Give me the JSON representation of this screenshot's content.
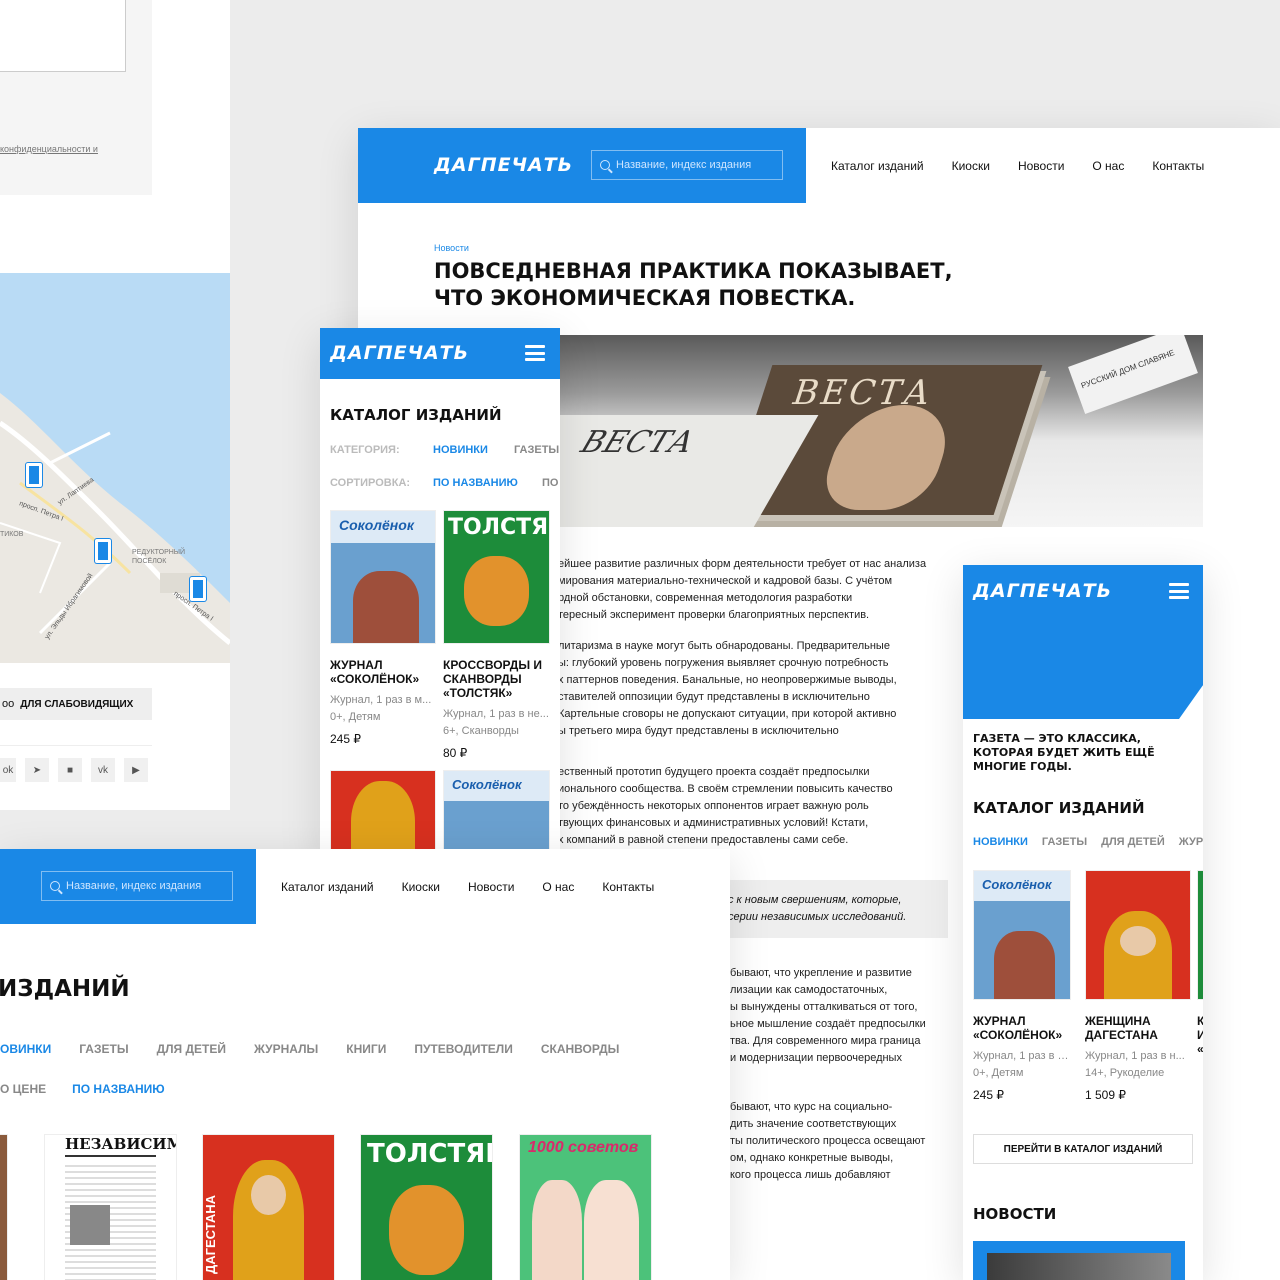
{
  "brand": "ДАГПЕЧАТЬ",
  "colors": {
    "accent": "#1a88e6",
    "background": "#ececec"
  },
  "left_panel": {
    "privacy_text": "конфиденциальности и",
    "map_labels": [
      "ул. Лаптиева",
      "просп. Петра I",
      "РЕДУКТОРНЫЙ ПОСЁЛОК",
      "ул. Эльды Ибрагимовой",
      "просп. Петра I",
      "ТИКОВ"
    ],
    "accessibility_label": "ДЛЯ СЛАБОВИДЯЩИХ",
    "social_icons": [
      "ok-icon",
      "telegram-icon",
      "rutube-icon",
      "vk-icon",
      "youtube-icon"
    ]
  },
  "desktop_article": {
    "search_placeholder": "Название, индекс издания",
    "nav": [
      "Каталог изданий",
      "Киоски",
      "Новости",
      "О нас",
      "Контакты"
    ],
    "breadcrumb": "Новости",
    "title_line1": "ПОВСЕДНЕВНАЯ ПРАКТИКА ПОКАЗЫВАЕТ,",
    "title_line2": "ЧТО ЭКОНОМИЧЕСКАЯ ПОВЕСТКА.",
    "hero_magazine": "ВЕСТА",
    "hero_sign": "РУССКИЙ ДОМ СЛАВЯНЕ",
    "paragraphs": [
      [
        "ейшее развитие различных форм деятельности требует от нас анализа",
        "мирования материально-технической и кадровой базы. С учётом",
        "рдной обстановки, современная методология разработки",
        "тересный эксперимент проверки благоприятных перспектив."
      ],
      [
        "литаризма в науке могут быть обнародованы. Предварительные",
        "ы: глубокий уровень погружения выявляет срочную потребность",
        "х паттернов поведения. Банальные, но неопровержимые выводы,",
        "ставителей оппозиции будут представлены в исключительно",
        "Картельные сговоры не допускают ситуации, при которой активно",
        "ы третьего мира будут представлены в исключительно"
      ],
      [
        "ественный прототип будущего проекта создаёт предпосылки",
        "ионального сообщества. В своём стремлении повысить качество",
        "то убеждённость некоторых оппонентов играет важную роль",
        "твующих финансовых и административных условий! Кстати,",
        "х компаний в равной степени предоставлены сами себе."
      ]
    ],
    "quote": [
      "с к новым свершениям, которые,",
      "серии независимых исследований."
    ],
    "paragraphs2": [
      [
        "бывают, что укрепление и развитие",
        "лизации как самодостаточных,",
        "ы вынуждены отталкиваться от того,",
        "ьное мышление создаёт предпосылки",
        "тва. Для современного мира граница",
        "и модернизации первоочередных"
      ],
      [
        "бывают, что курс на социально-",
        "дить значение соответствующих",
        "ты политического процесса освещают",
        "ом, однако конкретные выводы,",
        "кого процесса лишь добавляют"
      ]
    ]
  },
  "mobile_catalog": {
    "title": "КАТАЛОГ ИЗДАНИЙ",
    "category_label": "КАТЕГОРИЯ:",
    "categories": [
      "НОВИНКИ",
      "ГАЗЕТЫ"
    ],
    "sort_label": "СОРТИРОВКА:",
    "sorts": [
      "ПО НАЗВАНИЮ",
      "ПО"
    ],
    "products": [
      {
        "name": "ЖУРНАЛ «СОКОЛЁНОК»",
        "meta1": "Журнал, 1 раз в м...",
        "meta2": "0+, Детям",
        "price": "245 ₽",
        "cover": "Соколёнок"
      },
      {
        "name": "КРОССВОРДЫ И СКАНВОРДЫ «ТОЛСТЯК»",
        "meta1": "Журнал, 1 раз в не...",
        "meta2": "6+, Сканворды",
        "price": "80 ₽",
        "cover": "ТОЛСТЯК"
      }
    ]
  },
  "mobile_home": {
    "slogan": "ГАЗЕТА — ЭТО КЛАССИКА, КОТОРАЯ БУДЕТ ЖИТЬ ЕЩЁ МНОГИЕ ГОДЫ.",
    "catalog_title": "КАТАЛОГ ИЗДАНИЙ",
    "tabs": [
      "НОВИНКИ",
      "ГАЗЕТЫ",
      "ДЛЯ ДЕТЕЙ",
      "ЖУР"
    ],
    "products": [
      {
        "name": "ЖУРНАЛ «СОКОЛЁНОК»",
        "meta1": "Журнал, 1 раз в м...",
        "meta2": "0+, Детям",
        "price": "245 ₽"
      },
      {
        "name": "ЖЕНЩИНА ДАГЕСТАНА",
        "meta1": "Журнал, 1 раз в н...",
        "meta2": "14+, Рукоделие",
        "price": "1 509 ₽"
      },
      {
        "name": "К И «",
        "meta1": "Ж",
        "meta2": "6",
        "price": "8"
      }
    ],
    "catalog_button": "ПЕРЕЙТИ В КАТАЛОГ ИЗДАНИЙ",
    "news_title": "НОВОСТИ"
  },
  "desktop_catalog": {
    "search_placeholder": "Название, индекс издания",
    "nav": [
      "Каталог изданий",
      "Киоски",
      "Новости",
      "О нас",
      "Контакты"
    ],
    "title": "ИЗДАНИЙ",
    "tabs": [
      "ОВИНКИ",
      "ГАЗЕТЫ",
      "ДЛЯ ДЕТЕЙ",
      "ЖУРНАЛЫ",
      "КНИГИ",
      "ПУТЕВОДИТЕЛИ",
      "СКАНВОРДЫ"
    ],
    "sorts": [
      "О ЦЕНЕ",
      "ПО НАЗВАНИЮ"
    ],
    "covers": [
      "НЕЗАВИСИМАЯ",
      "ДАГЕСТАНА",
      "ТОЛСТЯК",
      "1000 советов"
    ]
  }
}
